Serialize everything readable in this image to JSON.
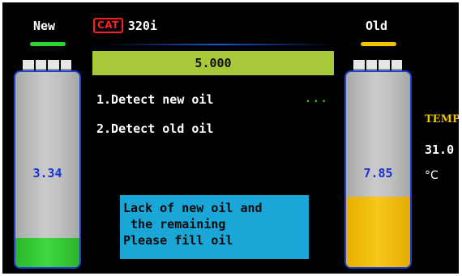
{
  "header": {
    "new_label": "New",
    "old_label": "Old",
    "brand_badge": "CAT",
    "model": "320i"
  },
  "colors": {
    "new_indicator": "#2fd52f",
    "old_indicator": "#f2c200",
    "brand": "#ff1f1f",
    "progress_bar": "#a7c93a",
    "message_box": "#1aa6d6",
    "tank_value_text": "#1630d6"
  },
  "progress": {
    "value": "5.000"
  },
  "steps": [
    {
      "label": "1.Detect new oil",
      "status": "..."
    },
    {
      "label": "2.Detect old oil"
    }
  ],
  "tanks": {
    "new": {
      "value": "3.34",
      "fill_fraction": 0.15
    },
    "old": {
      "value": "7.85",
      "fill_fraction": 0.36
    }
  },
  "message": {
    "lines": [
      "Lack of new oil and",
      " the remaining",
      "Please fill oil"
    ]
  },
  "temperature": {
    "label": "TEMP",
    "value": "31.0",
    "unit": "°C"
  },
  "icons": {
    "brand": "cat-logo-icon",
    "tank_cap": "tank-cap-icon"
  }
}
